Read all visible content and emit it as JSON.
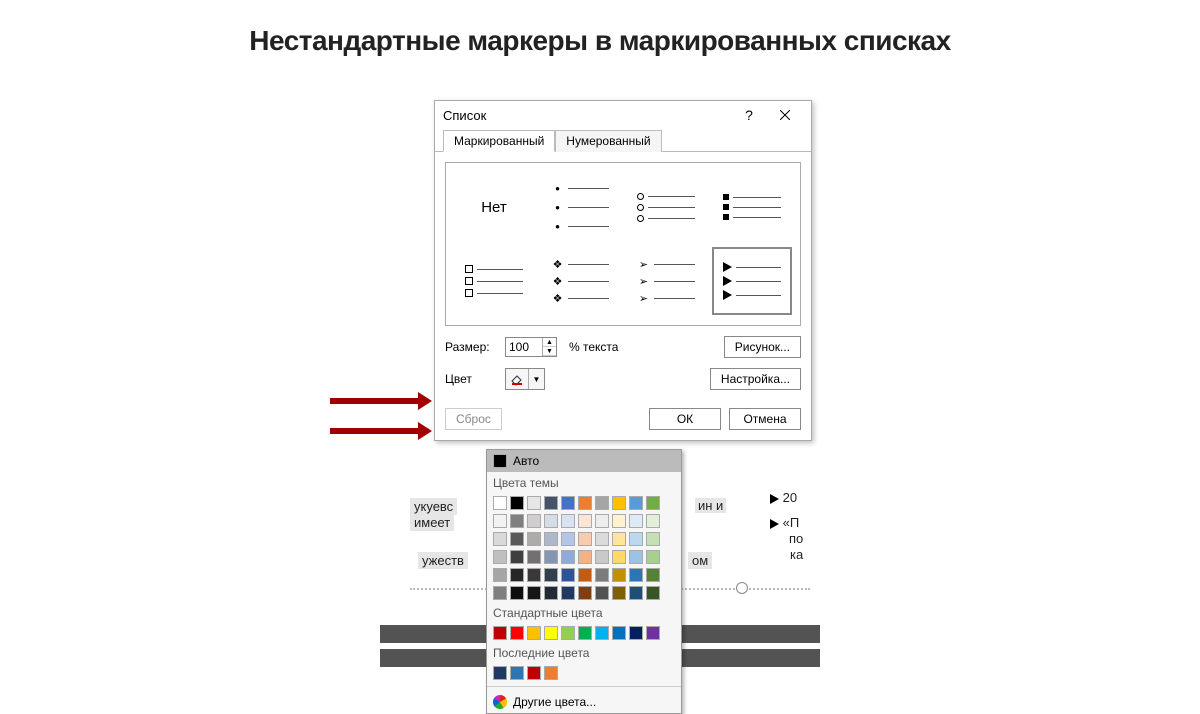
{
  "heading": "Нестандартные маркеры в маркированных списках",
  "dialog": {
    "title": "Список",
    "help": "?",
    "tab_bulleted": "Маркированный",
    "tab_numbered": "Нумерованный",
    "none_label": "Нет",
    "size_label": "Размер:",
    "size_value": "100",
    "size_unit": "% текста",
    "color_label": "Цвет",
    "btn_picture": "Рисунок...",
    "btn_customize": "Настройка...",
    "btn_reset": "Сброс",
    "btn_ok": "ОК",
    "btn_cancel": "Отмена"
  },
  "color_popup": {
    "auto": "Авто",
    "theme_title": "Цвета темы",
    "theme_row1": [
      "#ffffff",
      "#000000",
      "#e7e6e6",
      "#44546a",
      "#4472c4",
      "#ed7d31",
      "#a5a5a5",
      "#ffc000",
      "#5b9bd5",
      "#70ad47"
    ],
    "theme_shades": [
      [
        "#f2f2f2",
        "#7f7f7f",
        "#d0cece",
        "#d6dce5",
        "#d9e2f3",
        "#fbe5d6",
        "#ededed",
        "#fff2cc",
        "#deebf7",
        "#e2efda"
      ],
      [
        "#d9d9d9",
        "#595959",
        "#aeabab",
        "#adb9ca",
        "#b4c6e7",
        "#f7cbac",
        "#dbdbdb",
        "#fee599",
        "#bdd7ee",
        "#c5e0b4"
      ],
      [
        "#bfbfbf",
        "#3f3f3f",
        "#757070",
        "#8496b0",
        "#8eaadb",
        "#f4b183",
        "#c9c9c9",
        "#ffd965",
        "#9cc3e6",
        "#a8d08d"
      ],
      [
        "#a6a6a6",
        "#262626",
        "#3a3838",
        "#323f4f",
        "#2f5496",
        "#c55a11",
        "#7b7b7b",
        "#bf9000",
        "#2e75b6",
        "#538135"
      ],
      [
        "#7f7f7f",
        "#0d0d0d",
        "#171616",
        "#222a35",
        "#1f3864",
        "#833c0c",
        "#525252",
        "#7f6000",
        "#1e4e79",
        "#375623"
      ]
    ],
    "standard_title": "Стандартные цвета",
    "standard": [
      "#c00000",
      "#ff0000",
      "#ffc000",
      "#ffff00",
      "#92d050",
      "#00b050",
      "#00b0f0",
      "#0070c0",
      "#002060",
      "#7030a0"
    ],
    "recent_title": "Последние цвета",
    "recent": [
      "#1f3864",
      "#2e75b6",
      "#c00000",
      "#ed7d31"
    ],
    "more": "Другие цвета..."
  },
  "slide_fragments": {
    "f1": "укуевс",
    "f2": "имеет",
    "f3": "ин и",
    "f4": "ужеств",
    "f5": "ом",
    "r1": "20",
    "r2": "«П",
    "r3": "по",
    "r4": "ка"
  }
}
